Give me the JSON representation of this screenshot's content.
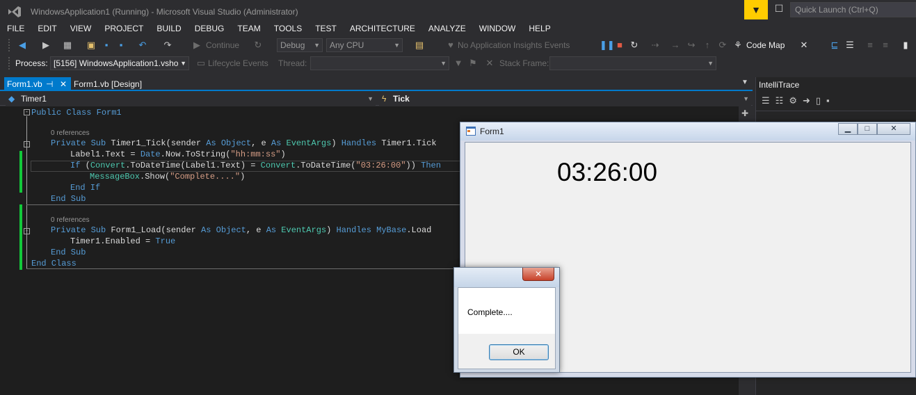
{
  "window": {
    "title": "WindowsApplication1 (Running) - Microsoft Visual Studio (Administrator)",
    "quick_launch_placeholder": "Quick Launch (Ctrl+Q)"
  },
  "menu": [
    "FILE",
    "EDIT",
    "VIEW",
    "PROJECT",
    "BUILD",
    "DEBUG",
    "TEAM",
    "TOOLS",
    "TEST",
    "ARCHITECTURE",
    "ANALYZE",
    "WINDOW",
    "HELP"
  ],
  "toolbar": {
    "continue_label": "Continue",
    "config": "Debug",
    "platform": "Any CPU",
    "insights": "No Application Insights Events",
    "code_map": "Code Map",
    "process_label": "Process:",
    "process_value": "[5156] WindowsApplication1.vsho",
    "lifecycle": "Lifecycle Events",
    "thread_label": "Thread:",
    "stack_frame_label": "Stack Frame:"
  },
  "tabs": {
    "active": "Form1.vb",
    "pin": "⊣",
    "close": "✕",
    "design": "Form1.vb [Design]"
  },
  "navbar": {
    "left": "Timer1",
    "right": "Tick"
  },
  "code": {
    "refs": "0 references",
    "line_class": [
      "Public Class",
      " ",
      "Form1"
    ],
    "tick_sub": [
      "Private Sub",
      " Timer1_Tick(sender ",
      "As",
      " ",
      "Object",
      ", e ",
      "As",
      " ",
      "EventArgs",
      ") ",
      "Handles",
      " Timer1.Tick"
    ],
    "label_line": [
      "Label1.Text = ",
      "Date",
      ".Now.ToString(",
      "\"hh:mm:ss\"",
      ")"
    ],
    "if_line": [
      "If",
      " (",
      "Convert",
      ".ToDateTime(Label1.Text) = ",
      "Convert",
      ".ToDateTime(",
      "\"03:26:00\"",
      ")) ",
      "Then"
    ],
    "msg_line": [
      "MessageBox",
      ".Show(",
      "\"Complete....\"",
      ")"
    ],
    "end_if": "End If",
    "end_sub": "End Sub",
    "load_sub": [
      "Private Sub",
      " Form1_Load(sender ",
      "As",
      " ",
      "Object",
      ", e ",
      "As",
      " ",
      "EventArgs",
      ") ",
      "Handles",
      " ",
      "MyBase",
      ".Load"
    ],
    "enabled_line": [
      "Timer1.Enabled = ",
      "True"
    ],
    "end_class": "End Class"
  },
  "intellitrace": {
    "title": "IntelliTrace"
  },
  "form1": {
    "title": "Form1",
    "label_text": "03:26:00"
  },
  "msgbox": {
    "text": "Complete....",
    "ok": "OK",
    "close": "✕"
  },
  "colors": {
    "accent": "#007acc",
    "editor_bg": "#1e1e1e",
    "keyword": "#569cd6",
    "type": "#4ec9b0",
    "string": "#d69d85",
    "changed_bar": "#12c93a",
    "notify": "#ffcc00"
  }
}
